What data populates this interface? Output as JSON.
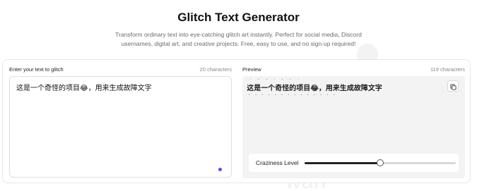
{
  "page": {
    "title": "Glitch Text Generator",
    "subtitle": "Transform ordinary text into eye-catching glitch art instantly. Perfect for social media, Discord usernames, digital art, and creative projects. Free, easy to use, and no sign-up required!"
  },
  "input": {
    "label": "Enter your text to glitch",
    "count": "20 characters",
    "value": "这是一个奇怪的项目😂，用来生成故障文字"
  },
  "preview": {
    "label": "Preview",
    "count": "119 characters",
    "glitch_text": "这是一个奇怪的项目😂，用来生成故障文字",
    "copy_icon": "copy-icon"
  },
  "craziness": {
    "label": "Craziness Level",
    "value_fraction": 0.5
  },
  "watermark": "wan",
  "colors": {
    "accent": "#5b4ee6",
    "preview_bg": "#f3f3f3"
  }
}
